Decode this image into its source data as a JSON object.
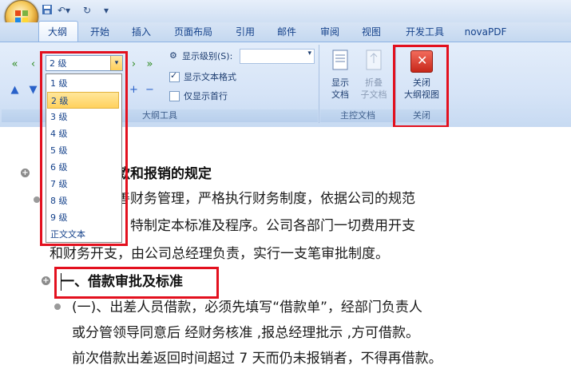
{
  "tabs": [
    "大纲",
    "开始",
    "插入",
    "页面布局",
    "引用",
    "邮件",
    "审阅",
    "视图",
    "开发工具",
    "novaPDF"
  ],
  "outline_group": {
    "level_selected": "2 级",
    "show_level_label": "显示级别(S):",
    "show_text_format": "显示文本格式",
    "show_text_format_checked": true,
    "show_first_line_only": "仅显示首行",
    "show_first_line_only_checked": false,
    "group_label": "大纲工具"
  },
  "master_group": {
    "show_doc": [
      "显示",
      "文档"
    ],
    "collapse_subdoc": [
      "折叠",
      "子文档"
    ],
    "group_label": "主控文档"
  },
  "close_group": {
    "close_label": [
      "关闭",
      "大纲视图"
    ],
    "group_label": "关闭"
  },
  "level_options": [
    "1 级",
    "2 级",
    "3 级",
    "4 级",
    "5 级",
    "6 级",
    "7 级",
    "8 级",
    "9 级",
    "正文文本"
  ],
  "document": {
    "heading1": "款和报销的规定",
    "para1_lines": [
      "善财务管理，严格执行财务制度，依据公司的规范",
      "，特制定本标准及程序。公司各部门一切费用开支",
      "和财务开支，由公司总经理负责，实行一支笔审批制度。"
    ],
    "heading2": "一、借款审批及标准",
    "para2_lines": [
      "(一)、出差人员借款，必须先填写“借款单”，经部门负责人",
      "或分管领导同意后 经财务核准 ,报总经理批示 ,方可借款。",
      "前次借款出差返回时间超过 7 天而仍未报销者，不得再借款。"
    ]
  },
  "colors": {
    "highlight_frame": "#e3101e",
    "ribbon": "#d6e4f7",
    "selected_item": "#ffd15d"
  }
}
